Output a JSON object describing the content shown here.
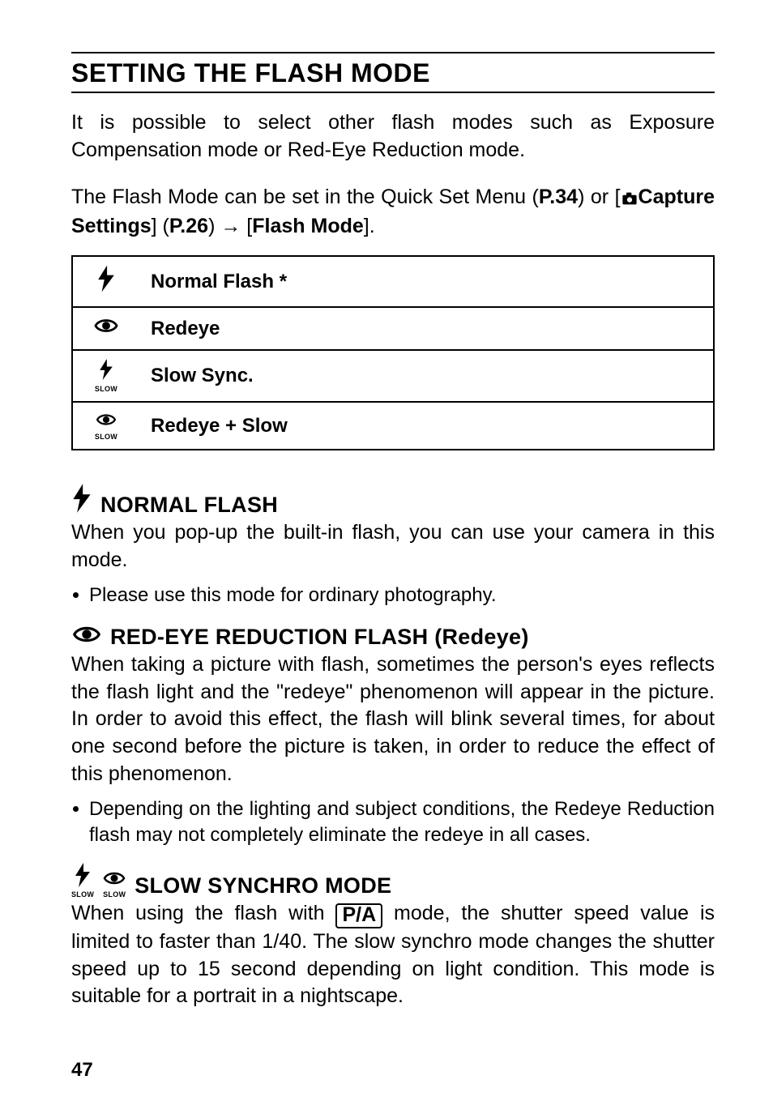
{
  "section_title": "SETTING THE FLASH MODE",
  "intro_p1": "It is possible to select other flash modes such as Exposure Compensation mode or Red-Eye Reduction mode.",
  "intro_p2_prefix": "The Flash Mode can be set in the Quick Set Menu (",
  "intro_p2_ref1": "P.34",
  "intro_p2_mid": ") or [",
  "intro_p2_capture": "Capture Settings",
  "intro_p2_mid2": "] (",
  "intro_p2_ref2": "P.26",
  "intro_p2_arrow_before": ") ",
  "intro_p2_arrow": "→",
  "intro_p2_after": " [",
  "intro_p2_flashmode": "Flash Mode",
  "intro_p2_end": "].",
  "table": {
    "rows": [
      {
        "icon": "flash",
        "label": "Normal Flash *"
      },
      {
        "icon": "eye",
        "label": "Redeye"
      },
      {
        "icon": "flash_slow",
        "label": "Slow Sync."
      },
      {
        "icon": "eye_slow",
        "label": "Redeye + Slow"
      }
    ]
  },
  "h_normal": "NORMAL FLASH",
  "normal_p": "When you pop-up the built-in flash, you can use your camera in this mode.",
  "normal_b1": "Please use this mode for ordinary photography.",
  "h_redeye": "RED-EYE REDUCTION FLASH (Redeye)",
  "redeye_p": "When taking a picture with flash, sometimes the person's eyes reflects the flash light and the \"redeye\" phenomenon will appear in the picture. In order to avoid this effect, the flash will blink several times, for about one second before the picture is taken, in order to reduce the effect of this phenomenon.",
  "redeye_b1": "Depending on the lighting and subject conditions, the Redeye Reduction flash may not completely eliminate the redeye in all cases.",
  "h_slow": "SLOW SYNCHRO MODE",
  "slow_p_prefix": "When using the flash with ",
  "slow_pa": "P/A",
  "slow_p_suffix": " mode, the shutter speed value is limited to faster than 1/40. The slow synchro mode changes the shutter speed up to 15 second depending on light condition. This mode is suitable for a portrait in a nightscape.",
  "slow_label": "SLOW",
  "page_number": "47"
}
